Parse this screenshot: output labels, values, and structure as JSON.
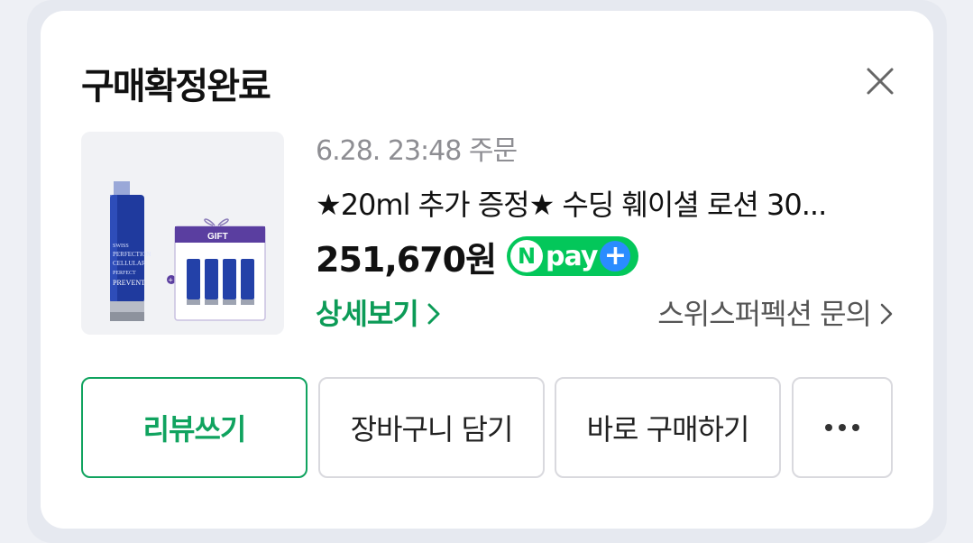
{
  "header": {
    "title": "구매확정완료"
  },
  "order": {
    "date_text": "6.28. 23:48 주문",
    "product_name": "★20ml 추가 증정★ 수딩 훼이셜 로션 30...",
    "price": "251,670원",
    "npay": {
      "badge_letter": "N",
      "badge_text": "pay",
      "badge_plus": "+"
    },
    "detail_link": "상세보기",
    "inquiry_link": "스위스퍼펙션 문의"
  },
  "thumbnail": {
    "gift_label": "GIFT",
    "bottle_text": "SWISS PERFECTION CELLULAR PERFECT PREVENT"
  },
  "actions": {
    "review": "리뷰쓰기",
    "cart": "장바구니 담기",
    "buy": "바로 구매하기",
    "more_icon": "more-dots-icon"
  },
  "colors": {
    "accent_green": "#10a35f",
    "npay_green": "#03c75a",
    "npay_blue": "#2a8cff"
  }
}
